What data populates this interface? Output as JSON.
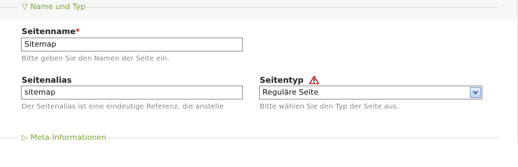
{
  "sections": {
    "name_und_typ": {
      "label": "Name und Typ",
      "expanded": true
    },
    "meta": {
      "label": "Meta-Informationen",
      "expanded": false
    }
  },
  "fields": {
    "seitenname": {
      "label": "Seitenname",
      "required_marker": "*",
      "value": "Sitemap",
      "hint": "Bitte geben Sie den Namen der Seite ein."
    },
    "seitenalias": {
      "label": "Seitenalias",
      "value": "sitemap",
      "hint": "Der Seitenalias ist eine eindeutige Referenz, die anstelle"
    },
    "seitentyp": {
      "label": "Seitentyp",
      "value": "Reguläre Seite",
      "hint": "Bitte wählen Sie den Typ der Seite aus.",
      "icon": "warning-icon"
    }
  },
  "colors": {
    "legend": "#7aa33a",
    "required": "#c0211a",
    "hint": "#888888"
  }
}
